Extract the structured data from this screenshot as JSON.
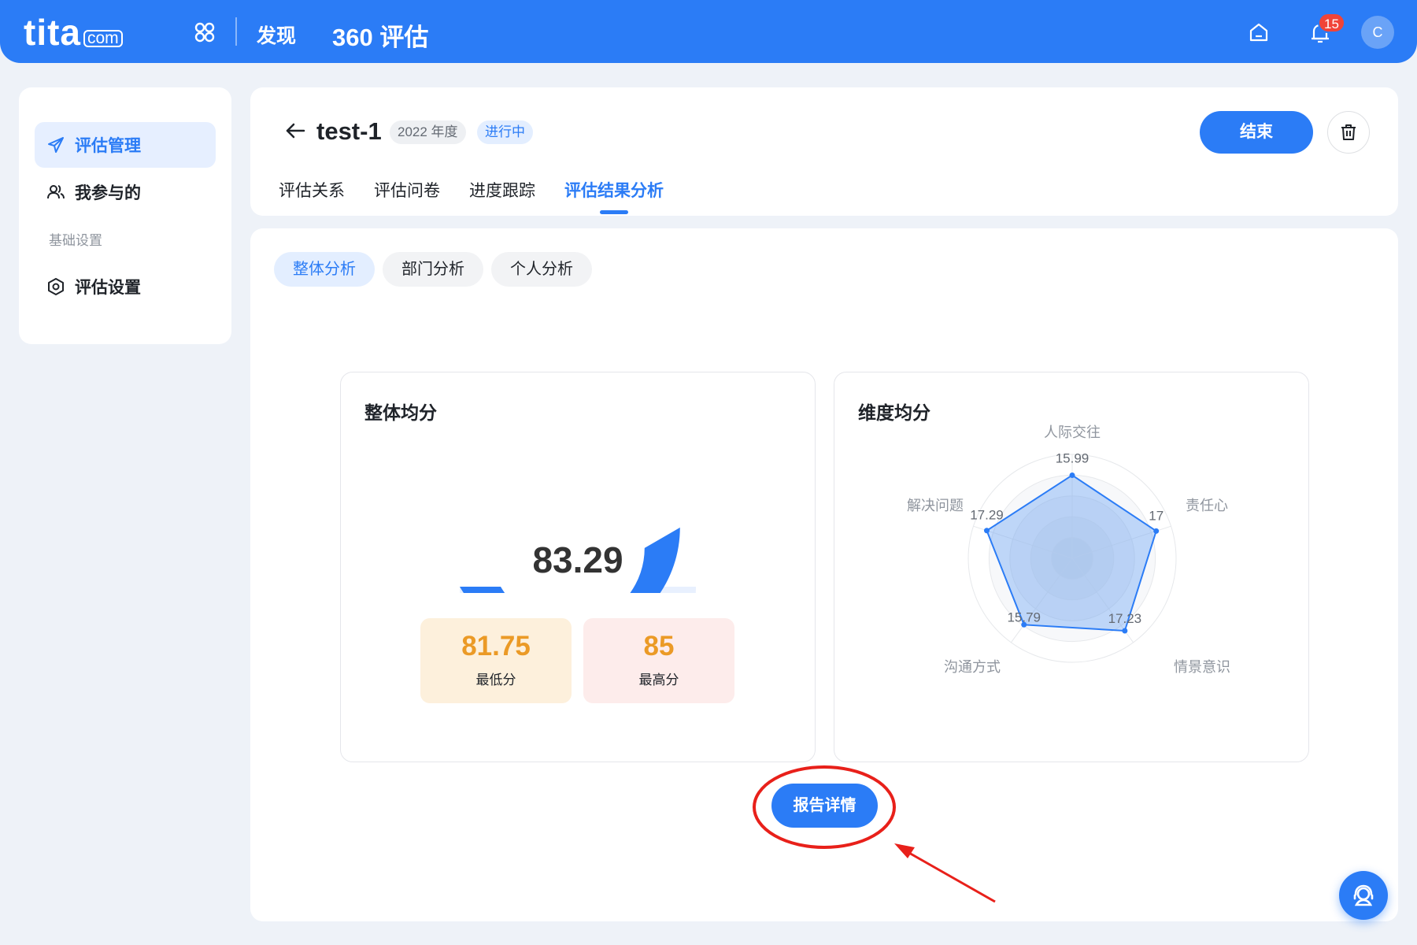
{
  "topbar": {
    "logo_main": "tita",
    "logo_suffix": "com",
    "nav_discover": "发现",
    "module_title": "360 评估",
    "notification_count": "15",
    "avatar_initial": "C"
  },
  "sidebar": {
    "items": [
      {
        "label": "评估管理",
        "icon": "send-icon",
        "active": true
      },
      {
        "label": "我参与的",
        "icon": "people-icon",
        "active": false
      }
    ],
    "section_label": "基础设置",
    "settings_item": {
      "label": "评估设置",
      "icon": "settings-icon"
    }
  },
  "header": {
    "title": "test-1",
    "year_tag": "2022 年度",
    "status_tag": "进行中",
    "end_button": "结束",
    "tabs": [
      "评估关系",
      "评估问卷",
      "进度跟踪",
      "评估结果分析"
    ],
    "active_tab": 3
  },
  "main": {
    "subtabs": [
      "整体分析",
      "部门分析",
      "个人分析"
    ],
    "active_subtab": 0,
    "overall": {
      "title": "整体均分",
      "score": "83.29",
      "min_value": "81.75",
      "min_label": "最低分",
      "max_value": "85",
      "max_label": "最高分"
    },
    "dimension": {
      "title": "维度均分"
    },
    "report_button": "报告详情"
  },
  "colors": {
    "primary": "#2b7cf6",
    "score_accent": "#eb9a26",
    "annotation": "#e8201a"
  },
  "chart_data": [
    {
      "type": "gauge",
      "value": 83.29,
      "range": [
        0,
        100
      ],
      "segments": 4
    },
    {
      "type": "radar",
      "axes": [
        "人际交往",
        "责任心",
        "情景意识",
        "沟通方式",
        "解决问题"
      ],
      "values": [
        15.99,
        17,
        17.23,
        15.79,
        17.29
      ],
      "range": [
        0,
        20
      ]
    }
  ]
}
